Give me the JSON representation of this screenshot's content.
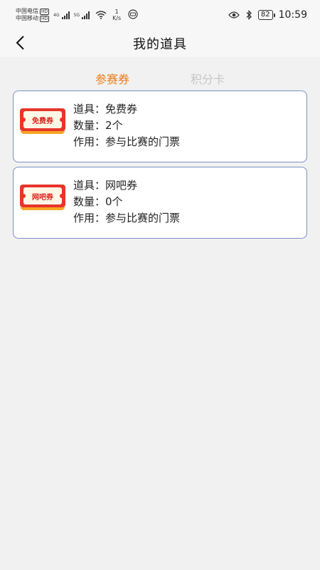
{
  "status_bar": {
    "carrier1": "中国电信",
    "carrier1_tag": "HD",
    "carrier2": "中国移动",
    "carrier2_tag": "HD",
    "net1": "4G",
    "net2": "5G",
    "speed_value": "1",
    "speed_unit": "K/s",
    "battery": "82",
    "time": "10:59"
  },
  "header": {
    "title": "我的道具"
  },
  "tabs": [
    {
      "label": "参赛券",
      "active": true
    },
    {
      "label": "积分卡",
      "active": false
    }
  ],
  "cards": [
    {
      "ticket_label": "免费券",
      "prop_line": "道具：免费券",
      "count_line": "数量：2个",
      "use_line": "作用：参与比赛的门票"
    },
    {
      "ticket_label": "网吧券",
      "prop_line": "道具：网吧券",
      "count_line": "数量：0个",
      "use_line": "作用：参与比赛的门票"
    }
  ],
  "colors": {
    "accent": "#e97e1d",
    "inactive_tab": "#c6c6c6",
    "card_border": "#7a90c2",
    "ticket_red": "#d8231c"
  }
}
